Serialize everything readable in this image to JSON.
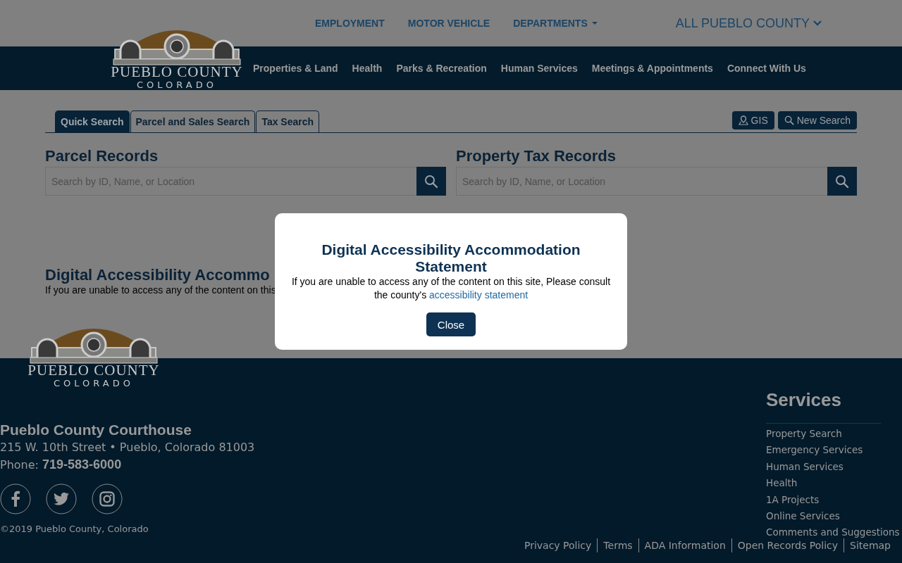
{
  "header": {
    "top_links": [
      {
        "label": "EMPLOYMENT",
        "dropdown": false
      },
      {
        "label": "MOTOR VEHICLE",
        "dropdown": false
      },
      {
        "label": "DEPARTMENTS",
        "dropdown": true
      }
    ],
    "county_select": "ALL PUEBLO COUNTY",
    "logo": {
      "name": "PUEBLO COUNTY",
      "subtitle": "COLORADO"
    },
    "nav": [
      "Properties & Land",
      "Health",
      "Parks & Recreation",
      "Human Services",
      "Meetings & Appointments",
      "Connect With Us"
    ]
  },
  "tabs": [
    {
      "label": "Quick Search",
      "selected": true
    },
    {
      "label": "Parcel and Sales Search",
      "selected": false
    },
    {
      "label": "Tax Search",
      "selected": false
    }
  ],
  "tools": [
    {
      "label": "GIS",
      "kind": "gis"
    },
    {
      "label": "New Search",
      "kind": "search"
    }
  ],
  "searches": [
    {
      "title": "Parcel Records",
      "placeholder": "Search by ID, Name, or Location"
    },
    {
      "title": "Property Tax Records",
      "placeholder": "Search by ID, Name, or Location"
    }
  ],
  "notice": {
    "title": "Digital Accessibility Accommo",
    "text": "If you are unable to access any of the content on this"
  },
  "footer": {
    "logo": {
      "name": "PUEBLO COUNTY",
      "subtitle": "COLORADO"
    },
    "name": "Pueblo County Courthouse",
    "address": "215 W. 10th Street • Pueblo, Colorado 81003",
    "phone": "Phone: **719-583-6000**",
    "social": [
      {
        "kind": "facebook"
      },
      {
        "kind": "twitter"
      },
      {
        "kind": "instagram"
      }
    ],
    "copyright": "©2019 Pueblo County, Colorado",
    "services": {
      "title": "Services",
      "links": [
        "Property Search",
        "Emergency Services",
        "Human Services",
        "Health",
        "1A Projects",
        "Online Services",
        "Comments and Suggestions"
      ]
    },
    "legal_links": [
      "Privacy Policy",
      "Terms",
      "ADA Information",
      "Open Records Policy",
      "Sitemap"
    ]
  },
  "modal": {
    "title": "Digital Accessibility Accommodation Statement",
    "text": "If you are unable to access any of the content on this site, Please consult the county's",
    "link": "accessibility statement",
    "button": "Close"
  }
}
